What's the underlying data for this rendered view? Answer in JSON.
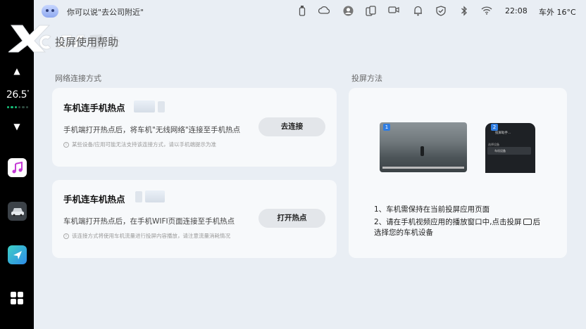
{
  "status_bar": {
    "voice_hint": "你可以说\"去公司附近\"",
    "time": "22:08",
    "outside_temp": "车外 16°C",
    "icons": [
      "bottle-icon",
      "cloud-icon",
      "account-icon",
      "phone-link-icon",
      "camera-icon",
      "bell-icon",
      "shield-icon",
      "bluetooth-icon",
      "wifi-icon"
    ]
  },
  "dock": {
    "temperature": "26.5",
    "temp_unit": "°",
    "apps": [
      "music-app-icon",
      "car-app-icon",
      "navigation-app-icon",
      "app-grid-icon"
    ]
  },
  "watermark": {
    "brand": "爱卡"
  },
  "page": {
    "title": "投屏使用帮助"
  },
  "sections": {
    "network": "网络连接方式",
    "cast_method": "投屏方法"
  },
  "cards": [
    {
      "title": "车机连手机热点",
      "desc": "手机端打开热点后，将车机\"无线网络\"连接至手机热点",
      "note": "某些设备/应用可能无法支持该连接方式，请以手机端提示为准",
      "button": "去连接"
    },
    {
      "title": "手机连车机热点",
      "desc": "车机端打开热点后，在手机WIFI页面连接至手机热点",
      "note": "该连接方式将使用车机流量进行投屏内容播放，请注意流量消耗情况",
      "button": "打开热点"
    }
  ],
  "cast": {
    "badge1": "1",
    "badge2": "2",
    "step1": "1、车机需保持在当前投屏应用页面",
    "step2a": "2、请在手机视频应用的播放窗口中,点击投屏",
    "step2b": "后",
    "step2c": "选择您的车机设备"
  },
  "colors": {
    "accent": "#2f7de1",
    "page_bg": "#e9eef4",
    "card_bg": "#f7f9fb",
    "dock_bg": "#000000"
  }
}
